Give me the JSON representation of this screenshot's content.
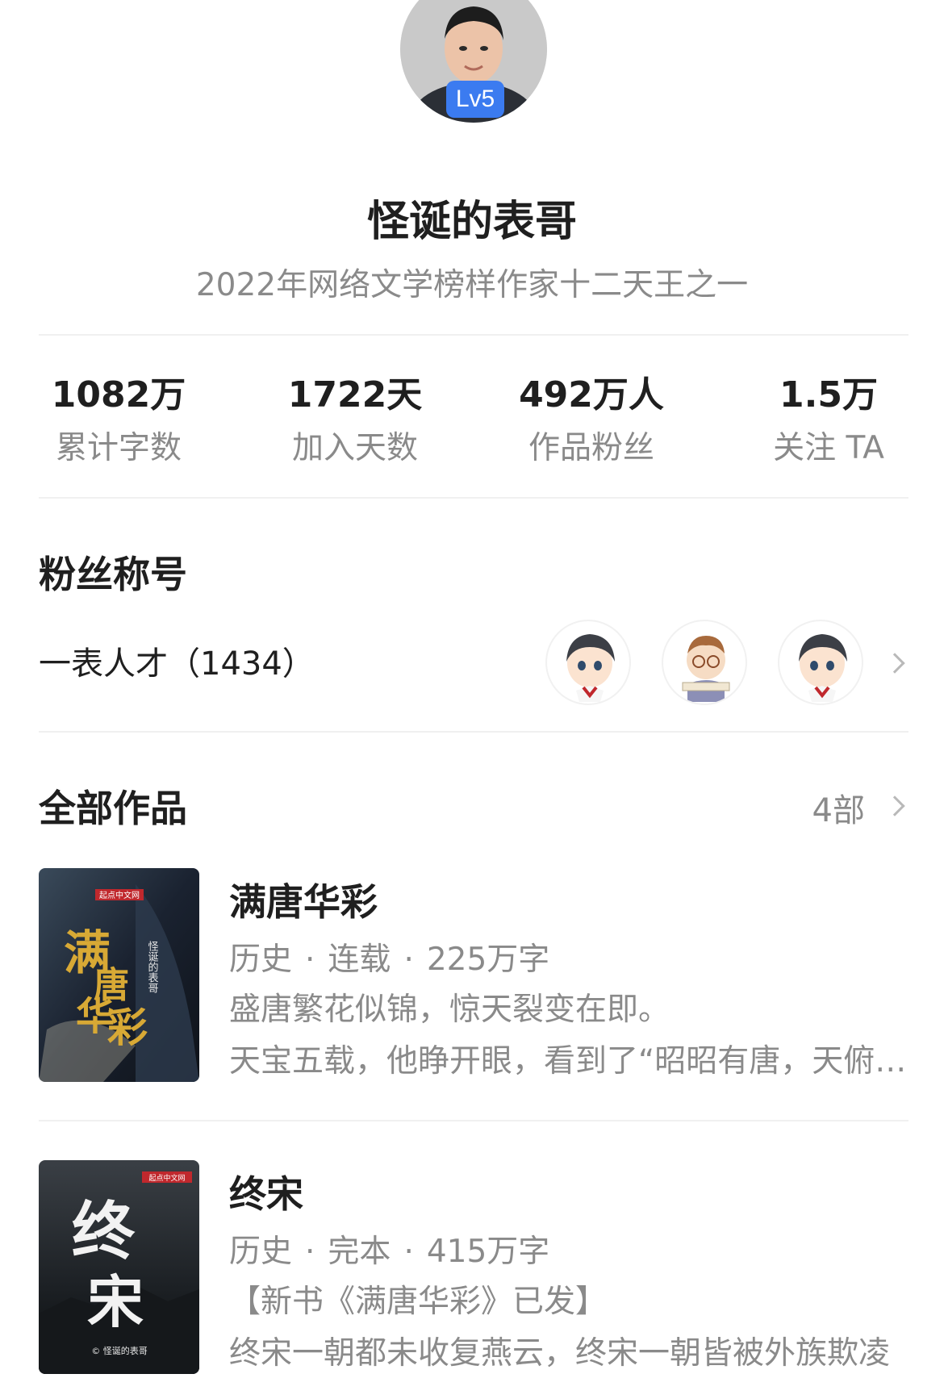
{
  "profile": {
    "level": "Lv5",
    "name": "怪诞的表哥",
    "description": "2022年网络文学榜样作家十二天王之一"
  },
  "stats": [
    {
      "value": "1082万",
      "label": "累计字数"
    },
    {
      "value": "1722天",
      "label": "加入天数"
    },
    {
      "value": "492万人",
      "label": "作品粉丝"
    },
    {
      "value": "1.5万",
      "label": "关注 TA"
    }
  ],
  "fan_title": {
    "heading": "粉丝称号",
    "title": "一表人才（1434）"
  },
  "works": {
    "heading": "全部作品",
    "count": "4部",
    "books": [
      {
        "title": "满唐华彩",
        "genre": "历史",
        "status": "连载",
        "words": "225万字",
        "desc_line1": "盛唐繁花似锦，惊天裂变在即。",
        "desc_line2": "天宝五载，他睁开眼，看到了“昭昭有唐，天俯群生”",
        "cover_text": {
          "publisher": "起点中文网",
          "big_title": "满唐华彩",
          "author": "怪诞的表哥"
        },
        "cover_color": "#1d2530"
      },
      {
        "title": "终宋",
        "genre": "历史",
        "status": "完本",
        "words": "415万字",
        "desc_line1": "【新书《满唐华彩》已发】",
        "desc_line2": "终宋一朝都未收复燕云，终宋一朝皆被外族欺凌",
        "cover_text": {
          "publisher": "起点中文网",
          "big_title": "终宋",
          "author": "© 怪诞的表哥"
        },
        "cover_color": "#23272c"
      }
    ]
  },
  "colors": {
    "accent": "#3b7bf0",
    "muted": "#8a8a8a",
    "text": "#1f1f1f",
    "gold": "#d8a935"
  }
}
